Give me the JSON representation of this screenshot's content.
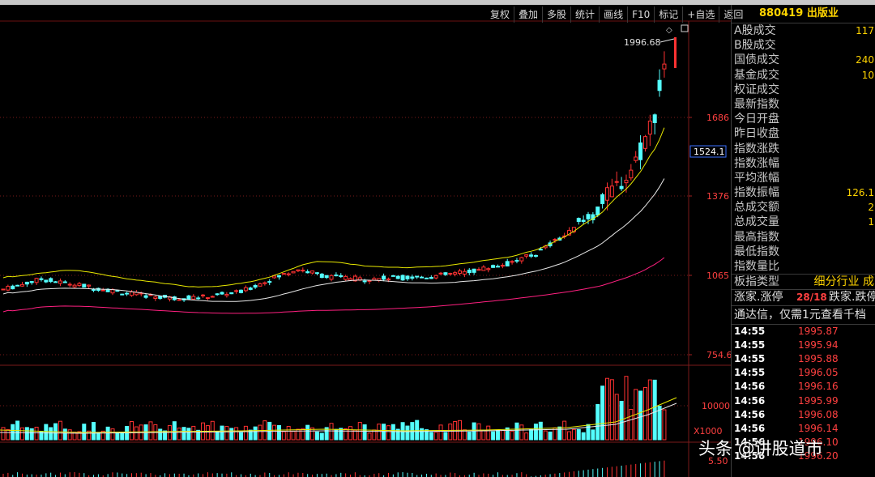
{
  "toolbar": {
    "buttons": [
      "复权",
      "叠加",
      "多股",
      "统计",
      "画线",
      "F10",
      "标记",
      "+自选",
      "返回"
    ]
  },
  "price_axis": {
    "labels": [
      "1686",
      "1376",
      "1065",
      "754.6"
    ],
    "current_label": "1524.1",
    "high_label": "1996.68"
  },
  "volume_axis": {
    "label": "10000",
    "unit": "X1000"
  },
  "third_axis_label": "5.50",
  "panel": {
    "code": "880419",
    "name": "出版业",
    "rows": [
      {
        "label": "A股成交",
        "value": "117"
      },
      {
        "label": "B股成交",
        "value": ""
      },
      {
        "label": "国债成交",
        "value": "240"
      },
      {
        "label": "基金成交",
        "value": "10"
      },
      {
        "label": "权证成交",
        "value": ""
      },
      {
        "label": "最新指数",
        "value": ""
      },
      {
        "label": "今日开盘",
        "value": ""
      },
      {
        "label": "昨日收盘",
        "value": ""
      },
      {
        "label": "指数涨跌",
        "value": ""
      },
      {
        "label": "指数涨幅",
        "value": ""
      },
      {
        "label": "平均涨幅",
        "value": ""
      },
      {
        "label": "指数振幅",
        "value": "126.1"
      },
      {
        "label": "总成交额",
        "value": "2"
      },
      {
        "label": "总成交量",
        "value": "1"
      },
      {
        "label": "最高指数",
        "value": ""
      },
      {
        "label": "最低指数",
        "value": ""
      },
      {
        "label": "指数量比",
        "value": ""
      }
    ],
    "type_label": "板指类型",
    "type_value": "细分行业 成",
    "up_label": "涨家.涨停",
    "up_value": "28/18",
    "down_label": "跌家.跌停",
    "ad_text": "通达信，仅需1元查看千档",
    "ticks": [
      {
        "time": "14:55",
        "price": "1995.87"
      },
      {
        "time": "14:55",
        "price": "1995.94"
      },
      {
        "time": "14:55",
        "price": "1995.88"
      },
      {
        "time": "14:55",
        "price": "1996.05"
      },
      {
        "time": "14:56",
        "price": "1996.16"
      },
      {
        "time": "14:56",
        "price": "1995.99"
      },
      {
        "time": "14:56",
        "price": "1996.08"
      },
      {
        "time": "14:56",
        "price": "1996.14"
      },
      {
        "time": "14:56",
        "price": "1996.10"
      },
      {
        "time": "14:56",
        "price": "1996.20"
      }
    ]
  },
  "watermark": "头条 @讲股道市",
  "colors": {
    "up": "#ff3232",
    "down": "#54ffff",
    "ma_white": "#e8e8e8",
    "ma_yellow": "#e8e800",
    "ma_pink": "#ff2080",
    "grid": "#7a1a1a"
  }
}
